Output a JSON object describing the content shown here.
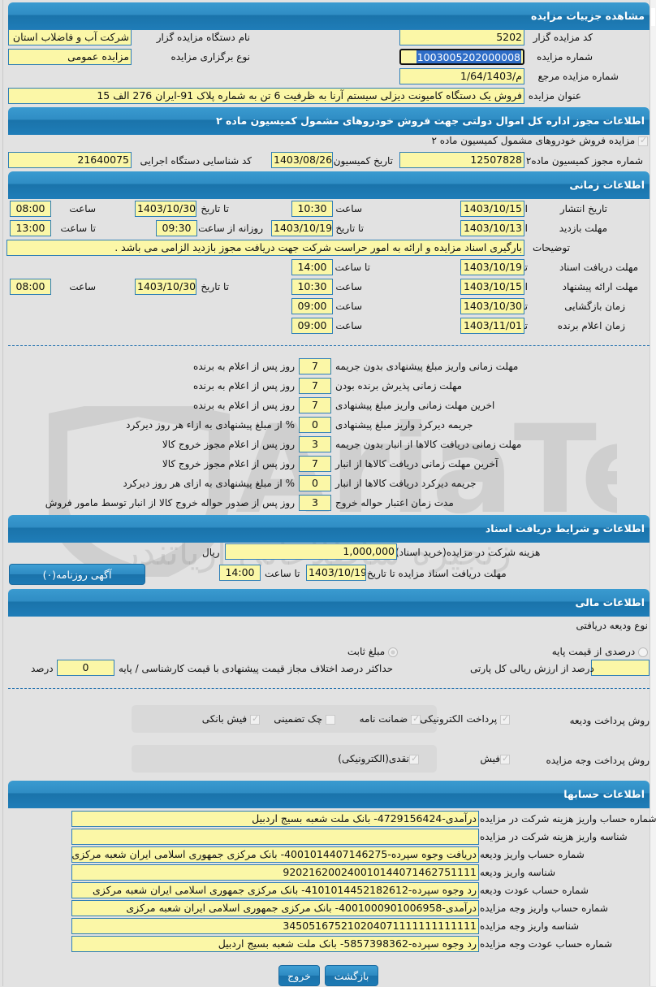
{
  "details": {
    "header": "مشاهده جزییات مزایده",
    "code_label": "کد مزایده گزار",
    "code_value": "5202",
    "org_label": "نام دستگاه مزایده گزار",
    "org_value": "شرکت آب و فاضلاب استان",
    "number_label": "شماره مزایده",
    "number_value": "1003005202000008",
    "type_label": "نوع برگزاری مزایده",
    "type_value": "مزایده عمومی",
    "ref_label": "شماره مزایده مرجع",
    "ref_value": "1/64/1403/م",
    "title_label": "عنوان مزایده",
    "title_value": "فروش یک دستگاه کامیونت دیزلی سیستم آرنا به ظرفیت 6 تن به شماره پلاک 91-ایران 276 الف 15"
  },
  "permit": {
    "header": "اطلاعات مجوز اداره کل اموال دولتی جهت فروش خودروهای مشمول کمیسیون ماده ۲",
    "checkbox_label": "مزایده فروش خودروهای مشمول کمیسیون ماده ۲",
    "checkbox_checked": true,
    "permit_no_label": "شماره مجوز کمیسیون ماده۲",
    "permit_no_value": "12507828",
    "date_label": "تاریخ کمیسیون",
    "date_value": "1403/08/26",
    "exec_code_label": "کد شناسایی دستگاه اجرایی",
    "exec_code_value": "21640075"
  },
  "timing": {
    "header": "اطلاعات زمانی",
    "publish_label": "تاریخ انتشار",
    "visit_label": "مهلت بازدید",
    "desc_label": "توضیحات",
    "docs_label": "مهلت دریافت اسناد",
    "offer_label": "مهلت ارائه پیشنهاد",
    "opening_label": "زمان بازگشایی",
    "winner_label": "زمان اعلام برنده",
    "from_date": "از تاریخ",
    "to_date": "تا تاریخ",
    "date": "تاریخ",
    "time": "ساعت",
    "to_time": "تا ساعت",
    "daily_from_time": "روزانه از ساعت",
    "publish_from_date": "1403/10/15",
    "publish_from_time": "10:30",
    "publish_to_date": "1403/10/30",
    "publish_to_time": "08:00",
    "visit_from_date": "1403/10/13",
    "visit_to_date": "1403/10/19",
    "visit_daily_from": "09:30",
    "visit_daily_to": "13:00",
    "description": "بارگیری اسناد مزایده و ارائه به امور حراست شرکت جهت دریافت مجوز بازدید الزامی می باشد .",
    "docs_to_date": "1403/10/19",
    "docs_to_time": "14:00",
    "offer_from_date": "1403/10/15",
    "offer_from_time": "10:30",
    "offer_to_date": "1403/10/30",
    "offer_to_time": "08:00",
    "opening_date": "1403/10/30",
    "opening_time": "09:00",
    "winner_date": "1403/11/01",
    "winner_time": "09:00"
  },
  "deadlines": [
    {
      "label": "مهلت زمانی واریز مبلغ پیشنهادی بدون جریمه",
      "value": "7",
      "unit": "روز پس از اعلام به برنده"
    },
    {
      "label": "مهلت زمانی پذیرش برنده بودن",
      "value": "7",
      "unit": "روز پس از اعلام به برنده"
    },
    {
      "label": "اخرین مهلت زمانی واریز مبلغ پیشنهادی",
      "value": "7",
      "unit": "روز پس از اعلام به برنده"
    },
    {
      "label": "جریمه دیرکرد واریز مبلغ پیشنهادی",
      "value": "0",
      "unit": "% از مبلغ پیشنهادی به ازاء هر روز دیرکرد"
    },
    {
      "label": "مهلت زمانی دریافت کالاها از انبار بدون جریمه",
      "value": "3",
      "unit": "روز پس از اعلام مجوز خروج کالا"
    },
    {
      "label": "آخرین مهلت زمانی دریافت کالاها از انبار",
      "value": "7",
      "unit": "روز پس از اعلام مجوز خروج کالا"
    },
    {
      "label": "جریمه دیرکرد دریافت کالاها از انبار",
      "value": "0",
      "unit": "% از مبلغ پیشنهادی به ازای هر روز دیرکرد"
    },
    {
      "label": "مدت زمان اعتبار حواله خروج",
      "value": "3",
      "unit": "روز پس از صدور حواله خروج کالا از انبار توسط مامور فروش"
    }
  ],
  "documents": {
    "header": "اطلاعات و شرایط دریافت اسناد",
    "fee_label": "هزینه شرکت در مزایده(خرید اسناد)",
    "fee_value": "1,000,000",
    "fee_unit": "ریال",
    "deadline_label": "مهلت دریافت اسناد مزایده تا تاریخ",
    "deadline_date": "1403/10/19",
    "deadline_time_label": "تا ساعت",
    "deadline_time": "14:00",
    "newspaper_button": "آگهی روزنامه(۰)"
  },
  "financial": {
    "header": "اطلاعات مالی",
    "deposit_type_label": "نوع ودیعه دریافتی",
    "option_percent": "درصدی از قیمت پایه",
    "option_fixed": "مبلغ ثابت",
    "percent_value_label": "درصد از ارزش ریالی کل پارتی",
    "percent_value": "",
    "max_diff_label": "حداکثر درصد اختلاف مجاز قیمت پیشنهادی با قیمت کارشناسی / پایه",
    "max_diff_value": "0",
    "max_diff_unit": "درصد",
    "deposit_method_label": "روش پرداخت ودیعه",
    "deposit_methods": [
      {
        "label": "پرداخت الکترونیکی",
        "checked": true
      },
      {
        "label": "ضمانت نامه",
        "checked": true
      },
      {
        "label": "چک تضمینی",
        "checked": false
      },
      {
        "label": "فیش بانکی",
        "checked": true
      }
    ],
    "payment_method_label": "روش پرداخت وجه مزایده",
    "payment_methods": [
      {
        "label": "فیش",
        "checked": true
      },
      {
        "label": "نقدی(الکترونیکی)",
        "checked": true
      }
    ]
  },
  "accounts": {
    "header": "اطلاعات حسابها",
    "rows": [
      {
        "label": "شماره حساب واریز هزینه شرکت در مزایده",
        "value": "درآمدی-4729156424- بانک ملت شعبه بسیج اردبیل"
      },
      {
        "label": "شناسه واریز هزینه شرکت در مزایده",
        "value": ""
      },
      {
        "label": "شماره حساب واریز ودیعه",
        "value": "دریافت وجوه سپرده-4001014407146275- بانک مرکزی جمهوری اسلامی ایران شعبه مرکزی"
      },
      {
        "label": "شناسه واریز ودیعه",
        "value": "920216200240010144071462751111"
      },
      {
        "label": "شماره حساب عودت ودیعه",
        "value": "رد وجوه سپرده-4101014452182612- بانک مرکزی جمهوری اسلامی ایران شعبه مرکزی"
      },
      {
        "label": "شماره حساب واریز وجه مزایده",
        "value": "درآمدی-4001000901006958- بانک مرکزی جمهوری اسلامی ایران شعبه مرکزی"
      },
      {
        "label": "شناسه واریز وجه مزایده",
        "value": "345051675210204071111111111111"
      },
      {
        "label": "شماره حساب عودت وجه مزایده",
        "value": "رد وجوه سپرده-5857398362- بانک ملت شعبه بسیج اردبیل"
      }
    ]
  },
  "buttons": {
    "back": "بازگشت",
    "exit": "خروج"
  },
  "watermark": {
    "brand": "AriaTender",
    "tagline": "زنجیره ساطلاعاتی آریاتندر"
  }
}
